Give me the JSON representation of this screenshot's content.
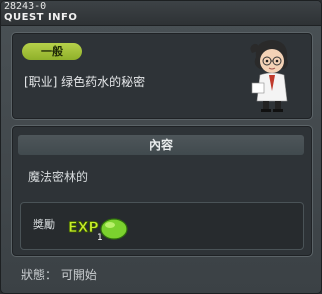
{
  "window": {
    "id_code": "28243-0",
    "title": "QUEST INFO"
  },
  "quest": {
    "category_badge": "一般",
    "name": "[职业] 绿色药水的秘密",
    "npc_icon": "npc-portrait-icon"
  },
  "content": {
    "header": "內容",
    "description": "魔法密林的",
    "reward_label": "獎勵",
    "reward_icon": "exp-icon",
    "reward_count": "1"
  },
  "status": {
    "text": "狀態： 可開始"
  },
  "colors": {
    "badge": "#9ebe34",
    "window_bg": "#444b4f",
    "panel_bg": "#2e3337"
  }
}
